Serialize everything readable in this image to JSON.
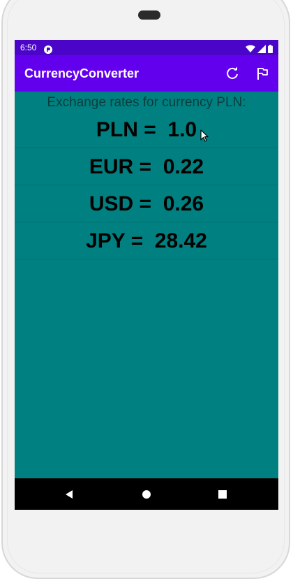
{
  "status_bar": {
    "time": "6:50",
    "icons": [
      "app-notification-icon",
      "wifi-icon",
      "cell-signal-icon",
      "battery-icon"
    ]
  },
  "app_bar": {
    "title": "CurrencyConverter",
    "actions": [
      "refresh-icon",
      "flag-icon"
    ]
  },
  "main": {
    "header": "Exchange rates for currency PLN:",
    "rates": [
      {
        "code": "PLN",
        "text": "PLN =  1.0"
      },
      {
        "code": "EUR",
        "text": "EUR =  0.22"
      },
      {
        "code": "USD",
        "text": "USD =  0.26"
      },
      {
        "code": "JPY",
        "text": "JPY =  28.42"
      }
    ]
  },
  "nav_bar": {
    "buttons": [
      "back-icon",
      "home-icon",
      "recents-icon"
    ]
  },
  "colors": {
    "status_bar": "#4a05c9",
    "app_bar": "#6200ee",
    "background": "#008080",
    "nav_bar": "#000000"
  }
}
